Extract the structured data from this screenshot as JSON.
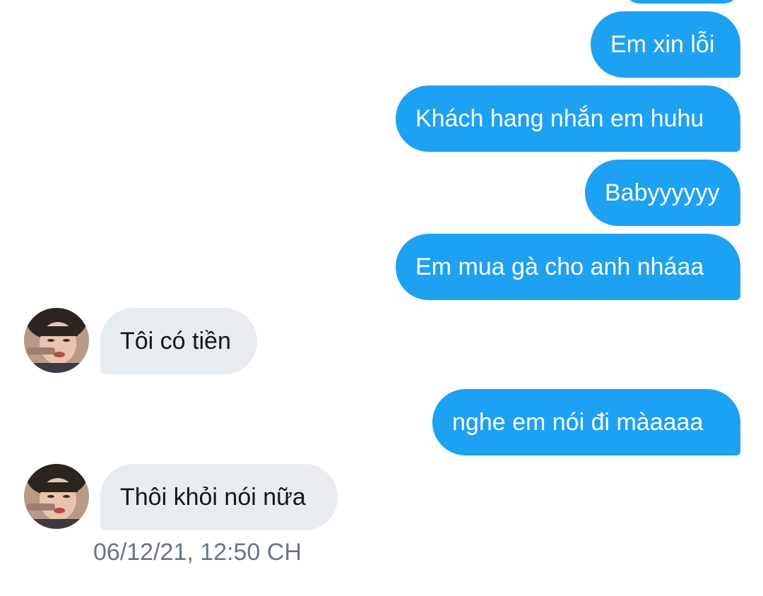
{
  "conversation": {
    "messages": [
      {
        "sender": "me",
        "text": "Em xin lỗi"
      },
      {
        "sender": "me",
        "text": "Khách hang nhắn em huhu"
      },
      {
        "sender": "me",
        "text": "Babyyyyyy"
      },
      {
        "sender": "me",
        "text": "Em mua gà cho anh nháaa"
      },
      {
        "sender": "them",
        "text": "Tôi có tiền"
      },
      {
        "sender": "me",
        "text": "nghe em nói đi màaaaa"
      },
      {
        "sender": "them",
        "text": "Thôi khỏi nói nữa"
      }
    ],
    "timestamp": "06/12/21, 12:50 CH"
  },
  "colors": {
    "sent_bubble": "#1da1f2",
    "received_bubble": "#e6ecf0",
    "timestamp_text": "#657786"
  },
  "icons": {
    "avatar": "contact-avatar-photo"
  }
}
